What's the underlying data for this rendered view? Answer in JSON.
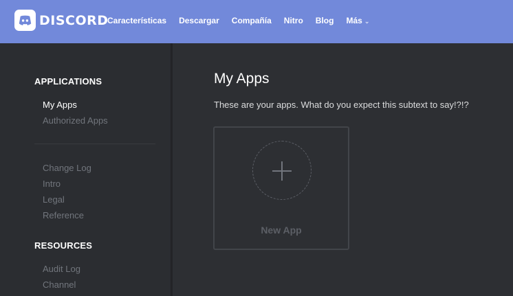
{
  "nav": {
    "brand": "DISCORD",
    "links": [
      "Características",
      "Descargar",
      "Compañía",
      "Nitro",
      "Blog",
      "Más"
    ]
  },
  "sidebar": {
    "applications_heading": "APPLICATIONS",
    "applications_items": [
      "My Apps",
      "Authorized Apps"
    ],
    "docs_items": [
      "Change Log",
      "Intro",
      "Legal",
      "Reference"
    ],
    "resources_heading": "RESOURCES",
    "resources_items": [
      "Audit Log",
      "Channel"
    ]
  },
  "main": {
    "title": "My Apps",
    "subtitle": "These are your apps. What do you expect this subtext to say!?!?",
    "new_app_label": "New App"
  },
  "colors": {
    "nav_bg": "#7289da",
    "sidebar_bg": "#2b2d31",
    "content_bg": "#2d2f33",
    "muted_text": "#72767d"
  }
}
